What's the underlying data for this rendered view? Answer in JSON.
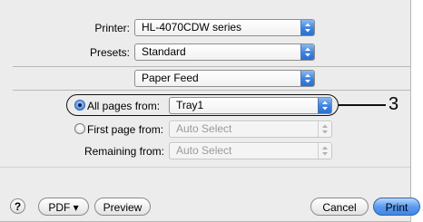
{
  "printer": {
    "label": "Printer:",
    "value": "HL-4070CDW series"
  },
  "presets": {
    "label": "Presets:",
    "value": "Standard"
  },
  "panel": {
    "value": "Paper Feed"
  },
  "paper_feed": {
    "all_pages_label": "All pages from:",
    "all_pages_value": "Tray1",
    "first_page_label": "First page from:",
    "first_page_value": "Auto Select",
    "remaining_label": "Remaining from:",
    "remaining_value": "Auto Select",
    "selected_option": "all_pages"
  },
  "callout": {
    "number": "3"
  },
  "buttons": {
    "help": "?",
    "pdf": "PDF ▾",
    "preview": "Preview",
    "cancel": "Cancel",
    "print": "Print"
  },
  "colors": {
    "accent": "#3c82e0",
    "dialog_bg": "#ececec"
  }
}
